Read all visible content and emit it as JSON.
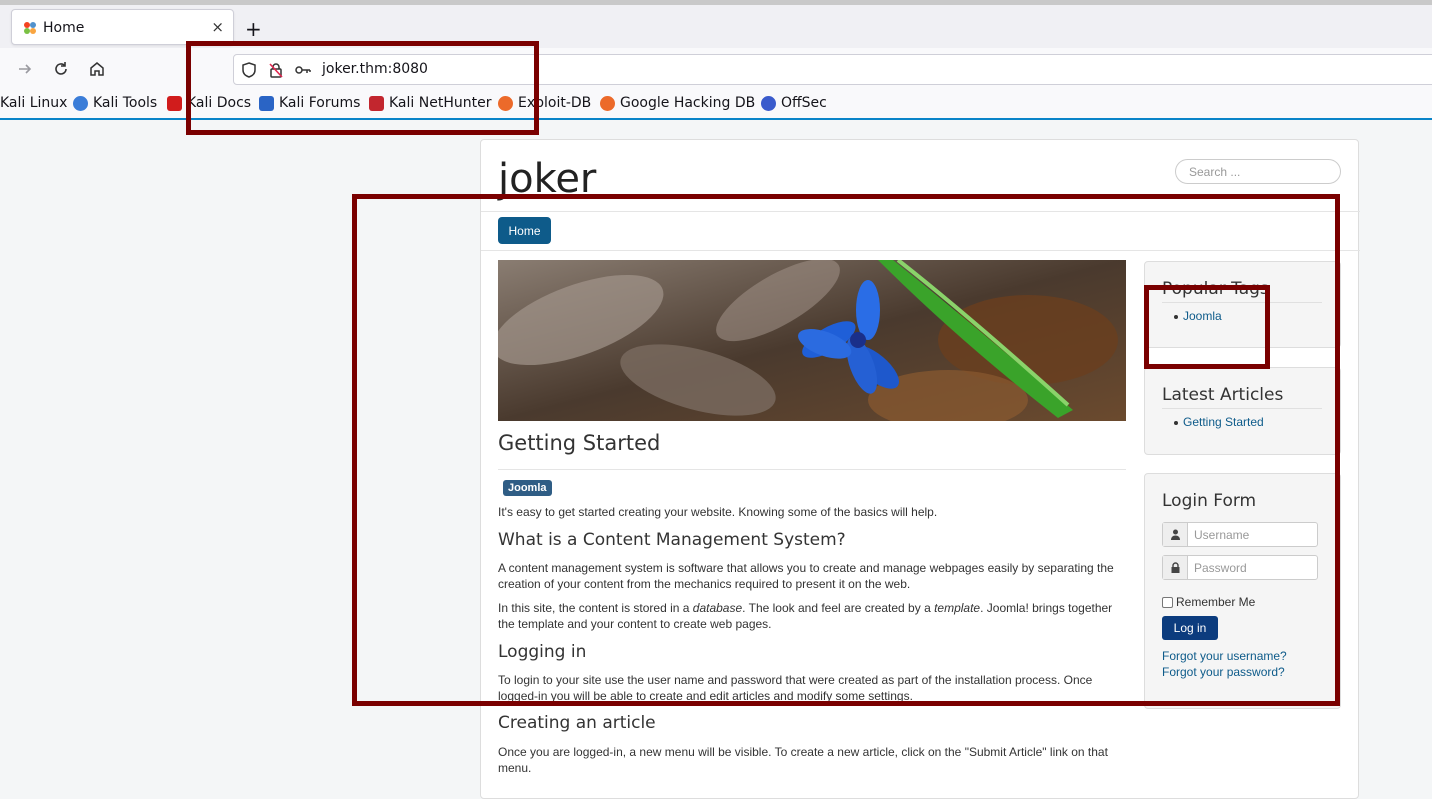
{
  "browser": {
    "tab_title": "Home",
    "tab_close": "×",
    "new_tab": "+",
    "url": "joker.thm:8080",
    "bookmarks": [
      "Kali Linux",
      "Kali Tools",
      "Kali Docs",
      "Kali Forums",
      "Kali NetHunter",
      "Exploit-DB",
      "Google Hacking DB",
      "OffSec"
    ]
  },
  "site": {
    "title": "joker",
    "search_placeholder": "Search ...",
    "menu_home": "Home"
  },
  "article": {
    "title": "Getting Started",
    "tag": "Joomla",
    "intro": "It's easy to get started creating your website. Knowing some of the basics will help.",
    "h_cms": "What is a Content Management System?",
    "p_cms": "A content management system is software that allows you to create and manage webpages easily by separating the creation of your content from the mechanics required to present it on the web.",
    "p_site_a": "In this site, the content is stored in a ",
    "p_site_db": "database",
    "p_site_b": ". The look and feel are created by a ",
    "p_site_tpl": "template",
    "p_site_c": ". Joomla! brings together the template and your content to create web pages.",
    "h_login": "Logging in",
    "p_login": "To login to your site use the user name and password that were created as part of the installation process. Once logged-in you will be able to create and edit articles and modify some settings.",
    "h_create": "Creating an article",
    "p_create": "Once you are logged-in, a new menu will be visible. To create a new article, click on the \"Submit Article\" link on that menu."
  },
  "sidebar": {
    "popular_tags_title": "Popular Tags",
    "popular_tags": [
      "Joomla"
    ],
    "latest_title": "Latest Articles",
    "latest": [
      "Getting Started"
    ],
    "login_title": "Login Form",
    "username_placeholder": "Username",
    "password_placeholder": "Password",
    "remember_me": "Remember Me",
    "login_button": "Log in",
    "forgot_username": "Forgot your username?",
    "forgot_password": "Forgot your password?"
  },
  "colors": {
    "annotation": "#7a0000",
    "link": "#0e5b8a",
    "home_button": "#0e5b8a",
    "login_button": "#0c3c7e"
  }
}
